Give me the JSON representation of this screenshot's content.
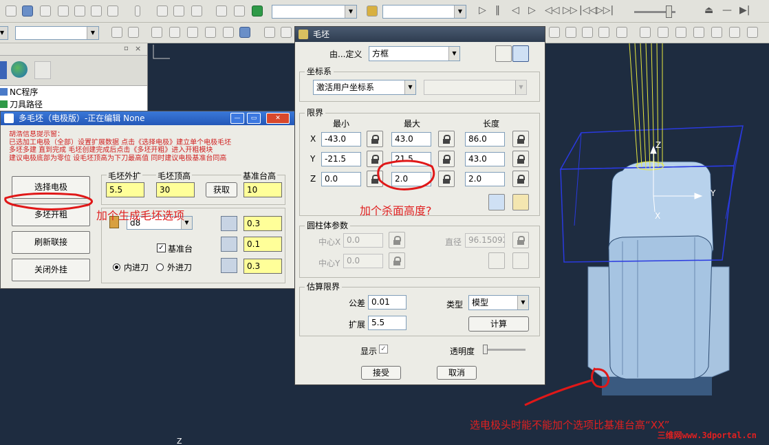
{
  "toolbar_top": {
    "icons": [
      "new-icon",
      "open-icon",
      "cut-icon",
      "copy-icon",
      "paste-icon",
      "undo-icon",
      "redo-icon",
      "gear-icon",
      "save-icon",
      "stop-icon",
      "close-icon"
    ],
    "playback": [
      "play-icon",
      "pause-icon",
      "step-back-icon",
      "step-forward-icon",
      "rewind-icon",
      "fast-forward-icon",
      "first-icon",
      "last-icon"
    ]
  },
  "multi_dialog": {
    "title": "多毛坯（电极版）-正在编辑 None",
    "tip_lines": [
      "胡浩信息提示窗：",
      "已选加工电极（全部）设置扩展数据 点击《选择电极》建立单个电极毛坯",
      "多坯多建 直到完成 毛坯创建完成后点击《多坯开粗》进入开粗模块",
      "建议电极底部为零位 设毛坯顶高为下刀最高值 同时建议电极基准台同高"
    ],
    "buttons": [
      "选择电极",
      "多坯开粗",
      "刷新联接",
      "关闭外挂"
    ],
    "label_expand": "毛坯外扩",
    "label_top_height": "毛坯顶高",
    "label_base_height": "基准台高",
    "value_expand": "5.5",
    "value_top_height": "30",
    "value_base_height": "10",
    "get_button": "获取",
    "tool_select": "d8",
    "value_1": "0.3",
    "value_2": "0.1",
    "value_3": "0.3",
    "base_checkbox_label": "基准台",
    "radio_inner": "内进刀",
    "radio_outer": "外进刀"
  },
  "navigator": {
    "items": [
      "NC程序",
      "刀具路径"
    ]
  },
  "blank_dialog": {
    "title": "毛坯",
    "defined_by_label": "由...定义",
    "defined_by_value": "方框",
    "coord_section": "坐标系",
    "coord_value": "激活用户坐标系",
    "limits_section": "限界",
    "col_min": "最小",
    "col_max": "最大",
    "col_length": "长度",
    "rows": [
      {
        "axis": "X",
        "min": "-43.0",
        "max": "43.0",
        "length": "86.0"
      },
      {
        "axis": "Y",
        "min": "-21.5",
        "max": "21.5",
        "length": "43.0"
      },
      {
        "axis": "Z",
        "min": "0.0",
        "max": "2.0",
        "length": "2.0"
      }
    ],
    "cylinder_section": "圆柱体参数",
    "center_x_label": "中心X",
    "center_x_value": "0.0",
    "center_y_label": "中心Y",
    "center_y_value": "0.0",
    "diameter_label": "直径",
    "diameter_value": "96.15092",
    "estimate_section": "估算限界",
    "tolerance_label": "公差",
    "tolerance_value": "0.01",
    "type_label": "类型",
    "type_value": "模型",
    "expand_label": "扩展",
    "expand_value": "5.5",
    "calc_button": "计算",
    "show_label": "显示",
    "opacity_label": "透明度",
    "accept_button": "接受",
    "cancel_button": "取消"
  },
  "annotations": {
    "note_blank_option": "加个生成毛坯选项",
    "note_kill_height": "加个杀面高度?",
    "note_electrode": "选电极头时能不能加个选项比基准台高“XX”",
    "watermark": "三维网www.3dportal.cn"
  },
  "viewport": {
    "axis_z": "Z",
    "axis_y": "Y",
    "axis_x": "X",
    "bottom_z": "Z"
  },
  "colors": {
    "annotation_red": "#e02020",
    "input_yellow": "#ffff99",
    "viewport_bg": "#1e2c40"
  }
}
